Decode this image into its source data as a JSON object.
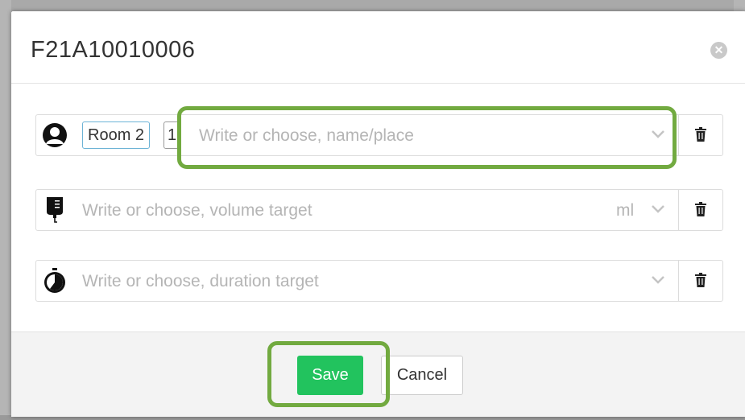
{
  "dialog": {
    "title": "F21A10010006",
    "close_icon": "close-icon"
  },
  "rows": {
    "place": {
      "icon": "person-icon",
      "chip_room": "Room 2",
      "chip_number": "1",
      "placeholder": "Write or choose, name/place"
    },
    "volume": {
      "icon": "iv-bag-icon",
      "placeholder": "Write or choose, volume target",
      "unit": "ml"
    },
    "duration": {
      "icon": "stopwatch-icon",
      "placeholder": "Write or choose, duration target"
    }
  },
  "footer": {
    "save_label": "Save",
    "cancel_label": "Cancel"
  },
  "colors": {
    "save": "#22c35e",
    "highlight": "#72aa40",
    "chip_border": "#6db3d6"
  }
}
